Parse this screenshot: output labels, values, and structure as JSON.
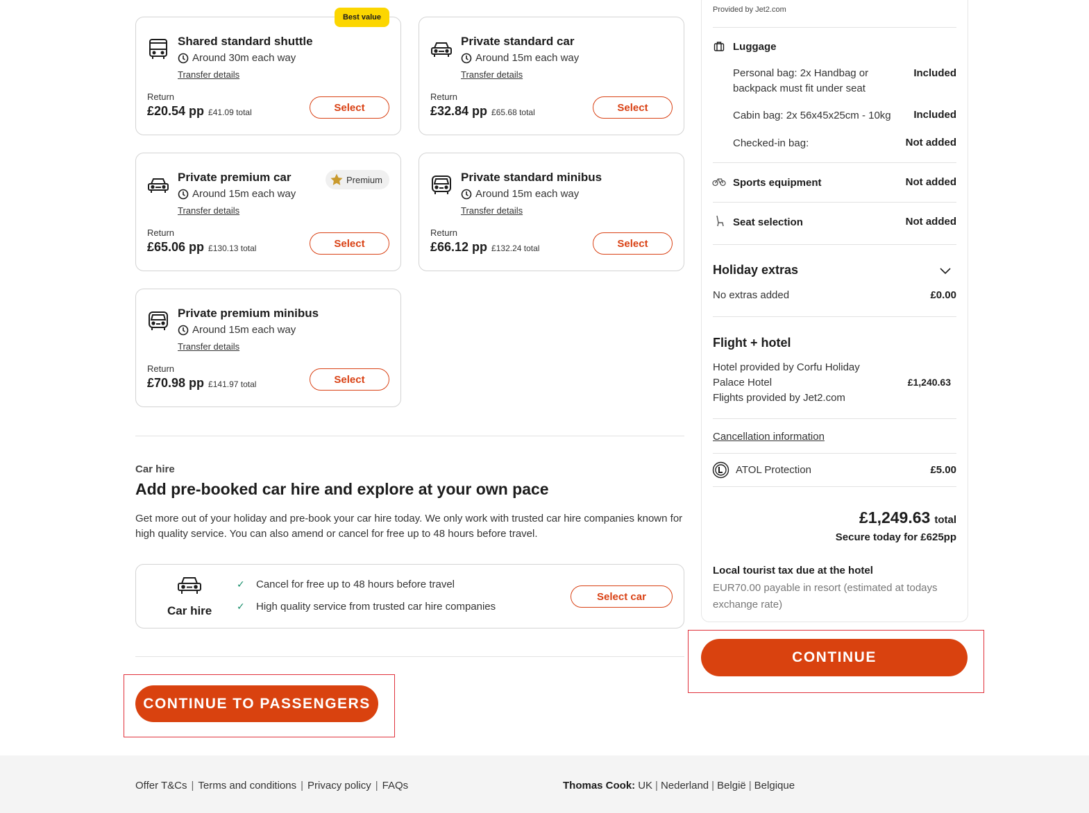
{
  "transfers": [
    {
      "title": "Shared standard shuttle",
      "duration": "Around 30m each way",
      "details": "Transfer details",
      "return_label": "Return",
      "price_pp": "£20.54 pp",
      "price_total": "£41.09 total",
      "select": "Select",
      "badge": "Best value",
      "icon": "bus-icon"
    },
    {
      "title": "Private standard car",
      "duration": "Around 15m each way",
      "details": "Transfer details",
      "return_label": "Return",
      "price_pp": "£32.84 pp",
      "price_total": "£65.68 total",
      "select": "Select",
      "icon": "car-icon"
    },
    {
      "title": "Private premium car",
      "duration": "Around 15m each way",
      "details": "Transfer details",
      "return_label": "Return",
      "price_pp": "£65.06 pp",
      "price_total": "£130.13 total",
      "select": "Select",
      "badge": "Premium",
      "icon": "car-icon"
    },
    {
      "title": "Private standard minibus",
      "duration": "Around 15m each way",
      "details": "Transfer details",
      "return_label": "Return",
      "price_pp": "£66.12 pp",
      "price_total": "£132.24 total",
      "select": "Select",
      "icon": "minibus-icon"
    },
    {
      "title": "Private premium minibus",
      "duration": "Around 15m each way",
      "details": "Transfer details",
      "return_label": "Return",
      "price_pp": "£70.98 pp",
      "price_total": "£141.97 total",
      "select": "Select",
      "icon": "minibus-icon"
    }
  ],
  "car_hire": {
    "kicker": "Car hire",
    "heading": "Add pre-booked car hire and explore at your own pace",
    "description": "Get more out of your holiday and pre-book your car hire today. We only work with trusted car hire companies known for high quality service. You can also amend or cancel for free up to 48 hours before travel.",
    "box_label": "Car hire",
    "features": [
      "Cancel for free up to 48 hours before travel",
      "High quality service from trusted car hire companies"
    ],
    "select_button": "Select car"
  },
  "continue_passengers": "CONTINUE TO PASSENGERS",
  "summary": {
    "provided_by": "Provided by Jet2.com",
    "luggage": {
      "title": "Luggage",
      "rows": [
        {
          "label": "Personal bag: 2x Handbag or backpack must fit under seat",
          "value": "Included"
        },
        {
          "label": "Cabin bag: 2x 56x45x25cm - 10kg",
          "value": "Included"
        },
        {
          "label": "Checked-in bag:",
          "value": "Not added"
        }
      ]
    },
    "sports": {
      "label": "Sports equipment",
      "value": "Not added"
    },
    "seats": {
      "label": "Seat selection",
      "value": "Not added"
    },
    "extras": {
      "title": "Holiday extras",
      "label": "No extras added",
      "value": "£0.00"
    },
    "flight_hotel": {
      "title": "Flight + hotel",
      "line1": "Hotel provided by Corfu Holiday",
      "line2": "Palace Hotel",
      "line3": "Flights provided by Jet2.com",
      "value": "£1,240.63"
    },
    "cancellation": "Cancellation information",
    "atol": {
      "label": "ATOL Protection",
      "value": "£5.00"
    },
    "total_amount": "£1,249.63",
    "total_word": "total",
    "secure_today": "Secure today for £625pp",
    "tax_title": "Local tourist tax due at the hotel",
    "tax_text": "EUR70.00 payable in resort (estimated at todays exchange rate)",
    "continue": "CONTINUE"
  },
  "footer": {
    "links": [
      "Offer T&Cs",
      "Terms and conditions",
      "Privacy policy",
      "FAQs"
    ],
    "separator": "|",
    "brand": "Thomas Cook:",
    "countries": [
      "UK",
      "Nederland",
      "België",
      "Belgique"
    ]
  },
  "colors": {
    "accent": "#d9420f",
    "badge_yellow": "#fcd600",
    "tick_green": "#1a8f6c",
    "highlight_frame": "#e0303a"
  }
}
